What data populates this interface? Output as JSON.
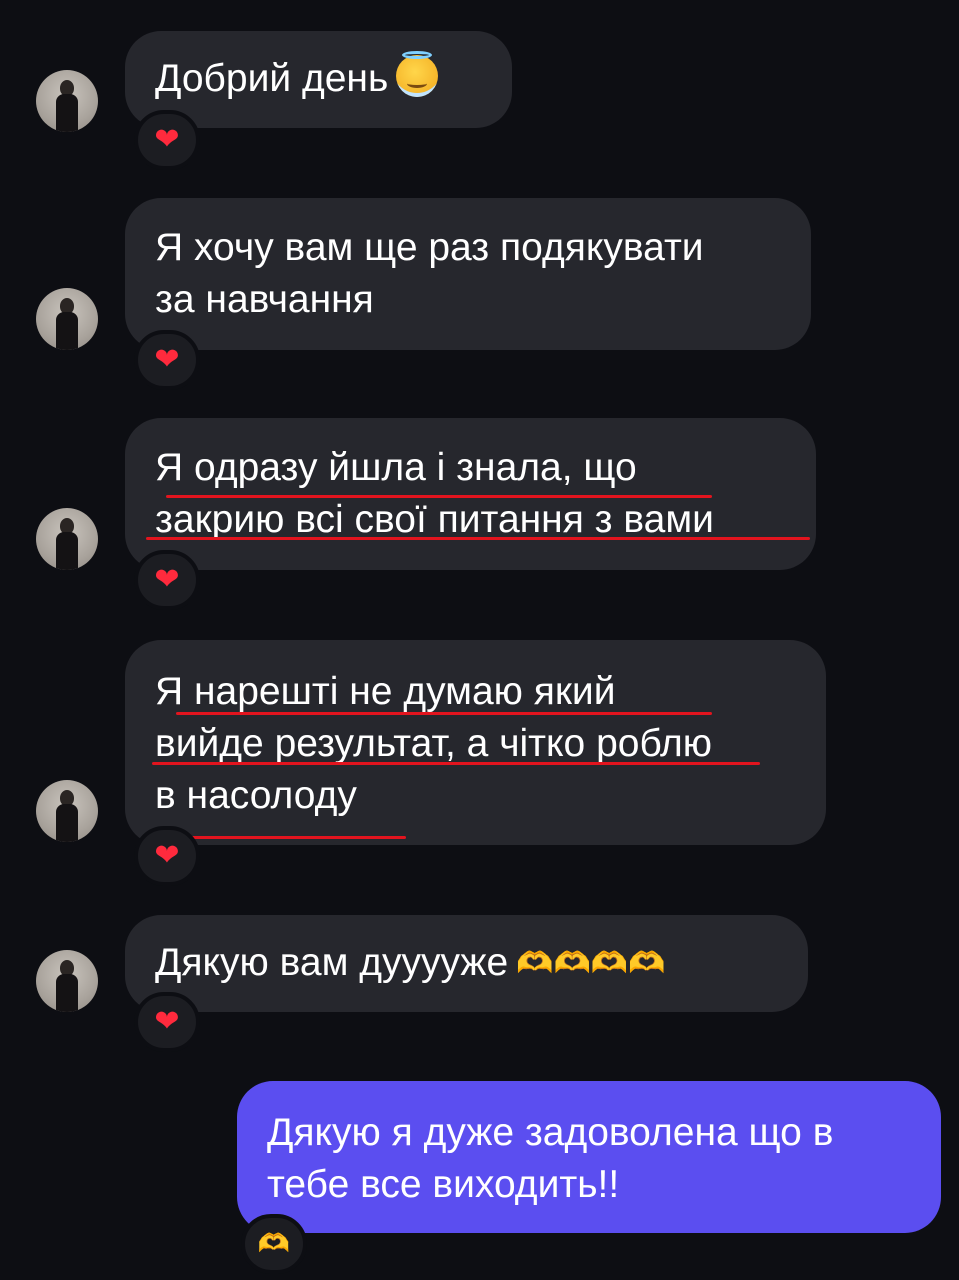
{
  "messages": [
    {
      "lines": [
        "Добрий день"
      ],
      "emoji": "smiling-face-with-halo",
      "reaction": "❤"
    },
    {
      "lines": [
        "Я хочу вам ще раз подякувати",
        "за навчання"
      ],
      "reaction": "❤"
    },
    {
      "lines": [
        "Я одразу йшла і знала, що",
        "закрию всі свої питання з вами"
      ],
      "reaction": "❤"
    },
    {
      "lines": [
        "Я нарешті не думаю який",
        "вийде результат, а чітко роблю",
        "в насолоду"
      ],
      "reaction": "❤"
    },
    {
      "lines": [
        "Дякую вам дууууже"
      ],
      "trailing_emoji": "🫶🫶🫶🫶",
      "reaction": "❤"
    }
  ],
  "outgoing": {
    "lines": [
      "Дякую я дуже задоволена що в",
      "тебе все виходить!!"
    ],
    "reaction": "🫶"
  },
  "colors": {
    "background": "#0d0e13",
    "incoming_bubble": "#26272d",
    "outgoing_bubble": "#5b4ef0",
    "underline": "#e2141e",
    "heart": "#ff2a3d"
  }
}
